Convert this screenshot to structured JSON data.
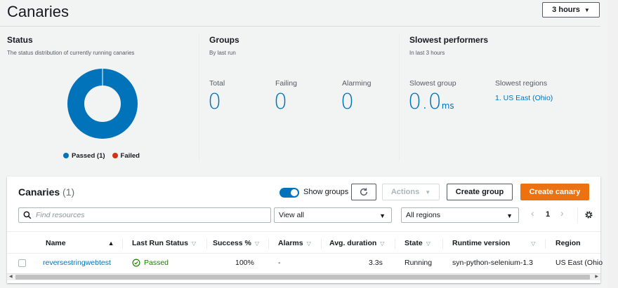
{
  "page": {
    "title": "Canaries"
  },
  "time_range": {
    "label": "3 hours"
  },
  "status": {
    "title": "Status",
    "subtitle": "The status distribution of currently running canaries",
    "passed_label": "Passed (1)",
    "failed_label": "Failed",
    "passed_count": 1,
    "failed_count": 0,
    "passed_color": "#0073bb",
    "failed_color": "#d13212"
  },
  "groups": {
    "title": "Groups",
    "subtitle": "By last run",
    "total_label": "Total",
    "total_value": "0",
    "failing_label": "Failing",
    "failing_value": "0",
    "alarming_label": "Alarming",
    "alarming_value": "0"
  },
  "slowest": {
    "title": "Slowest performers",
    "subtitle": "In last 3 hours",
    "group_label": "Slowest group",
    "group_value": "0.0",
    "group_unit": "ms",
    "regions_label": "Slowest regions",
    "region_1": "1. US East (Ohio)"
  },
  "canaries_panel": {
    "title": "Canaries",
    "count": "(1)",
    "show_groups_label": "Show groups",
    "show_groups_on": true,
    "actions_label": "Actions",
    "create_group_label": "Create group",
    "create_canary_label": "Create canary",
    "search_placeholder": "Find resources",
    "filter_value": "View all",
    "region_value": "All regions",
    "page_number": "1",
    "columns": {
      "name": "Name",
      "last_run": "Last Run Status",
      "success": "Success %",
      "alarms": "Alarms",
      "avg_duration": "Avg. duration",
      "state": "State",
      "runtime": "Runtime version",
      "region": "Region"
    },
    "rows": [
      {
        "name": "reversestringwebtest",
        "last_run": "Passed",
        "success": "100%",
        "alarms": "-",
        "avg_duration": "3.3s",
        "state": "Running",
        "runtime": "syn-python-selenium-1.3",
        "region": "US East (Ohio"
      }
    ]
  },
  "icons": {
    "search": "search-icon",
    "refresh": "refresh-icon",
    "settings": "gear-icon",
    "passed": "check-circle-icon"
  }
}
